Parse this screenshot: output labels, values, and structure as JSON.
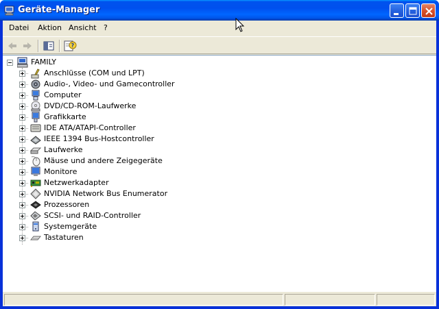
{
  "window": {
    "title": "Geräte-Manager",
    "title_icon": "device-manager-icon",
    "controls": [
      "minimize-icon",
      "maximize-icon",
      "close-icon"
    ]
  },
  "menu": {
    "items": [
      {
        "label": "Datei"
      },
      {
        "label": "Aktion"
      },
      {
        "label": "Ansicht"
      },
      {
        "label": "?"
      }
    ]
  },
  "toolbar": {
    "buttons": [
      {
        "icon": "back-arrow-icon"
      },
      {
        "icon": "forward-arrow-icon"
      },
      {
        "icon": "show-hide-console-tree-icon"
      },
      {
        "icon": "properties-help-icon"
      }
    ]
  },
  "tree": {
    "root": {
      "label": "FAMILY",
      "icon": "computer-icon",
      "expanded": true
    },
    "items": [
      {
        "label": "Anschlüsse (COM und LPT)",
        "icon": "port-icon"
      },
      {
        "label": "Audio-, Video- und Gamecontroller",
        "icon": "audio-icon"
      },
      {
        "label": "Computer",
        "icon": "computer-icon"
      },
      {
        "label": "DVD/CD-ROM-Laufwerke",
        "icon": "dvd-drive-icon"
      },
      {
        "label": "Grafikkarte",
        "icon": "display-adapter-icon"
      },
      {
        "label": "IDE ATA/ATAPI-Controller",
        "icon": "ide-controller-icon"
      },
      {
        "label": "IEEE 1394 Bus-Hostcontroller",
        "icon": "firewire-icon"
      },
      {
        "label": "Laufwerke",
        "icon": "disk-drive-icon"
      },
      {
        "label": "Mäuse und andere Zeigegeräte",
        "icon": "mouse-icon"
      },
      {
        "label": "Monitore",
        "icon": "monitor-icon"
      },
      {
        "label": "Netzwerkadapter",
        "icon": "network-adapter-icon"
      },
      {
        "label": "NVIDIA Network Bus Enumerator",
        "icon": "bus-enumerator-icon"
      },
      {
        "label": "Prozessoren",
        "icon": "processor-icon"
      },
      {
        "label": "SCSI- und RAID-Controller",
        "icon": "scsi-controller-icon"
      },
      {
        "label": "Systemgeräte",
        "icon": "system-device-icon"
      },
      {
        "label": "Tastaturen",
        "icon": "keyboard-icon"
      }
    ]
  },
  "colors": {
    "titlebar": "#0054e3",
    "chrome": "#ece9d8",
    "tree_background": "#ffffff"
  }
}
